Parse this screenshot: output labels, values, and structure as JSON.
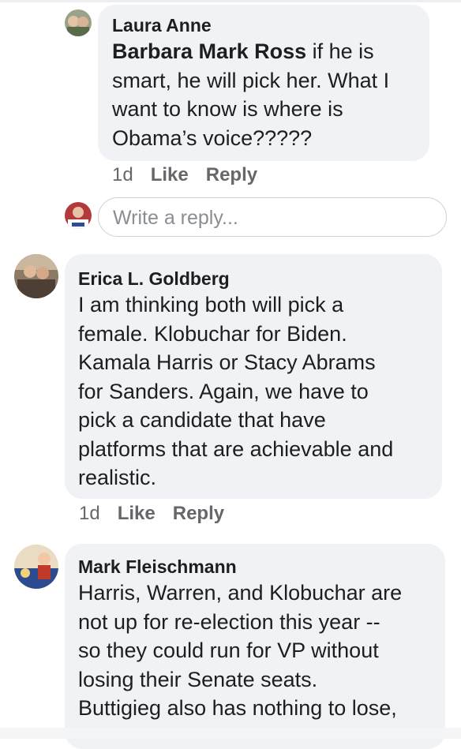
{
  "comments": [
    {
      "author": "Laura Anne",
      "mention": "Barbara Mark Ross",
      "lines": [
        "if he is",
        "smart, he will pick her. What I",
        "want to know is where is",
        "Obama’s voice?????"
      ],
      "time": "1d",
      "like_label": "Like",
      "reply_label": "Reply"
    },
    {
      "author": "Erica L. Goldberg",
      "lines": [
        "I am thinking both will pick a",
        "female. Klobuchar for Biden.",
        "Kamala Harris or Stacy Abrams",
        "for Sanders.  Again, we have to",
        "pick a candidate that have",
        "platforms that are achievable and",
        "realistic."
      ],
      "time": "1d",
      "like_label": "Like",
      "reply_label": "Reply"
    },
    {
      "author": "Mark Fleischmann",
      "lines": [
        "Harris, Warren, and Klobuchar are",
        "not up for re-election this year --",
        "so they could run for VP without",
        "losing their Senate seats.",
        "Buttigieg also has nothing to lose,"
      ]
    }
  ],
  "reply_input": {
    "placeholder": "Write a reply..."
  },
  "colors": {
    "bubble": "#f0f2f5",
    "meta": "#65676b",
    "text": "#1c1e21"
  }
}
